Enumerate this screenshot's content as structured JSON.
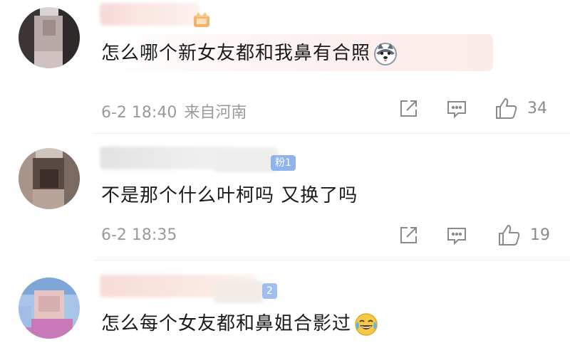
{
  "comments": [
    {
      "text": "怎么哪个新女友都和我鼻有合照",
      "date": "6-2 18:40",
      "location": "来自河南",
      "likes": "34",
      "emoji": "husky-dog-emoji"
    },
    {
      "text": "不是那个什么叶柯吗 又换了吗",
      "date": "6-2 18:35",
      "location": "",
      "likes": "19",
      "badge": "粉1"
    },
    {
      "text": "怎么每个女友都和鼻姐合影过",
      "badge": "2",
      "emoji": "laughing-crying-emoji"
    }
  ],
  "icons": {
    "share": "share-icon",
    "reply": "comment-icon",
    "like": "thumbs-up-icon"
  },
  "colors": {
    "meta_text": "#9a9a9a",
    "badge_blue": "#8fb4ec"
  }
}
